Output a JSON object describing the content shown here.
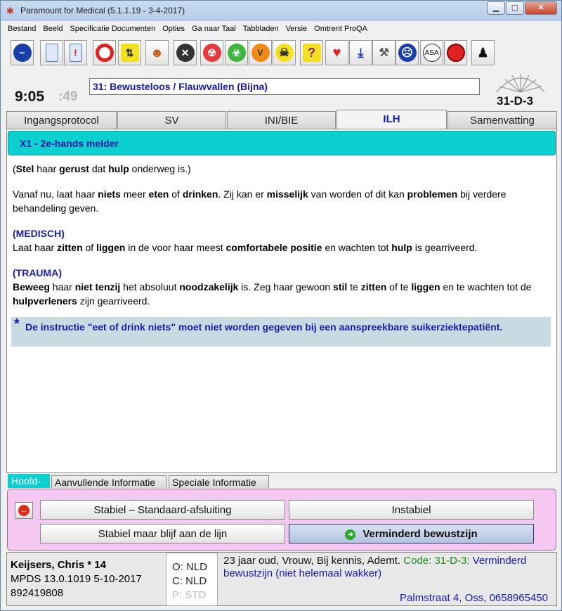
{
  "window": {
    "title": "Paramount for Medical (5.1.1.19 - 3-4-2017)"
  },
  "menu": [
    "Bestand",
    "Beeld",
    "Specificatie Documenten",
    "Opties",
    "Ga naar Taal",
    "Tabbladen",
    "Versie",
    "Omtrent ProQA"
  ],
  "toolbar_icons": [
    "stop-icon",
    "document-icon",
    "alert-document-icon",
    "target-icon",
    "arrows-updown-icon",
    "person-icon",
    "x-circle-icon",
    "radiation-icon",
    "biohazard-icon",
    "vehicle-icon",
    "skull-icon",
    "question-icon",
    "heart-icon",
    "down-arrow-icon",
    "tools-icon",
    "face-icon",
    "asa-icon",
    "record-icon",
    "spy-icon"
  ],
  "toolbar_labels": {
    "asa": "ASA",
    "question": "?",
    "vehicle": "V"
  },
  "clock": {
    "time": "9:05",
    "seconds": ":49"
  },
  "protocol": "31:  Bewusteloos / Flauwvallen (Bijna)",
  "determinant_code": "31-D-3",
  "tabs": [
    "Ingangsprotocol",
    "SV",
    "INI/BIE",
    "ILH",
    "Samenvatting"
  ],
  "active_tab": "ILH",
  "banner": "X1 - 2e-hands melder",
  "instructions": {
    "p1": {
      "a": "(",
      "b": "Stel",
      "c": " haar ",
      "d": "gerust",
      "e": " dat ",
      "f": "hulp",
      "g": " onderweg is.)"
    },
    "p2": {
      "a": "Vanaf nu, laat haar ",
      "b": "niets",
      "c": " meer ",
      "d": "eten",
      "e": " of ",
      "f": "drinken",
      "g": ".  Zij kan er ",
      "h": "misselijk",
      "i": " van worden of dit kan ",
      "j": "problemen",
      "k": " bij verdere behandeling geven."
    },
    "medisch_head": "(MEDISCH)",
    "p3": {
      "a": "Laat haar ",
      "b": "zitten",
      "c": " of ",
      "d": "liggen",
      "e": " in de voor haar meest ",
      "f": "comfortabele positie",
      "g": " en wachten tot ",
      "h": "hulp",
      "i": " is gearriveerd."
    },
    "trauma_head": "(TRAUMA)",
    "p4": {
      "a": "Beweeg",
      "b": " haar ",
      "c": "niet tenzij",
      "d": " het absoluut ",
      "e": "noodzakelijk",
      "f": " is.  Zeg haar gewoon ",
      "g": "stil",
      "h": " te ",
      "i": "zitten",
      "j": " of te ",
      "k": "liggen",
      "l": " en te wachten tot de ",
      "m": "hulpverleners",
      "n": " zijn gearriveerd."
    }
  },
  "note": {
    "star": "*",
    "text": "De instructie \"eet of drink niets\" moet niet worden gegeven bij een aanspreekbare suikerziektepatiënt."
  },
  "bottom_tabs": [
    "Hoofd-",
    "Aanvullende Informatie",
    "Speciale Informatie"
  ],
  "actions": {
    "stable_end": "Stabiel – Standaard-afsluiting",
    "unstable": "Instabiel",
    "stable_stay": "Stabiel maar blijf aan de lijn",
    "reduced_consciousness": "Verminderd bewustzijn"
  },
  "caller": {
    "name": "Keijsers, Chris",
    "age": "* 14",
    "mpds": "MPDS  13.0.1019  5-10-2017",
    "number": "892419808"
  },
  "languages": {
    "o": "O: NLD",
    "c": "C: NLD",
    "p": "P: STD"
  },
  "patient": {
    "summary": "23 jaar oud, Vrouw, Bij kennis, Ademt. ",
    "code": "Code: 31-D-3:",
    "description": " Verminderd bewustzijn (niet helemaal wakker)"
  },
  "address": "Palmstraat 4, Oss, 0658965450",
  "colors": {
    "accent_blue": "#1a1aa8",
    "banner_cyan": "#0ccfcf",
    "action_pink": "#f5c8f2",
    "note_bg": "#c8dbe2"
  }
}
